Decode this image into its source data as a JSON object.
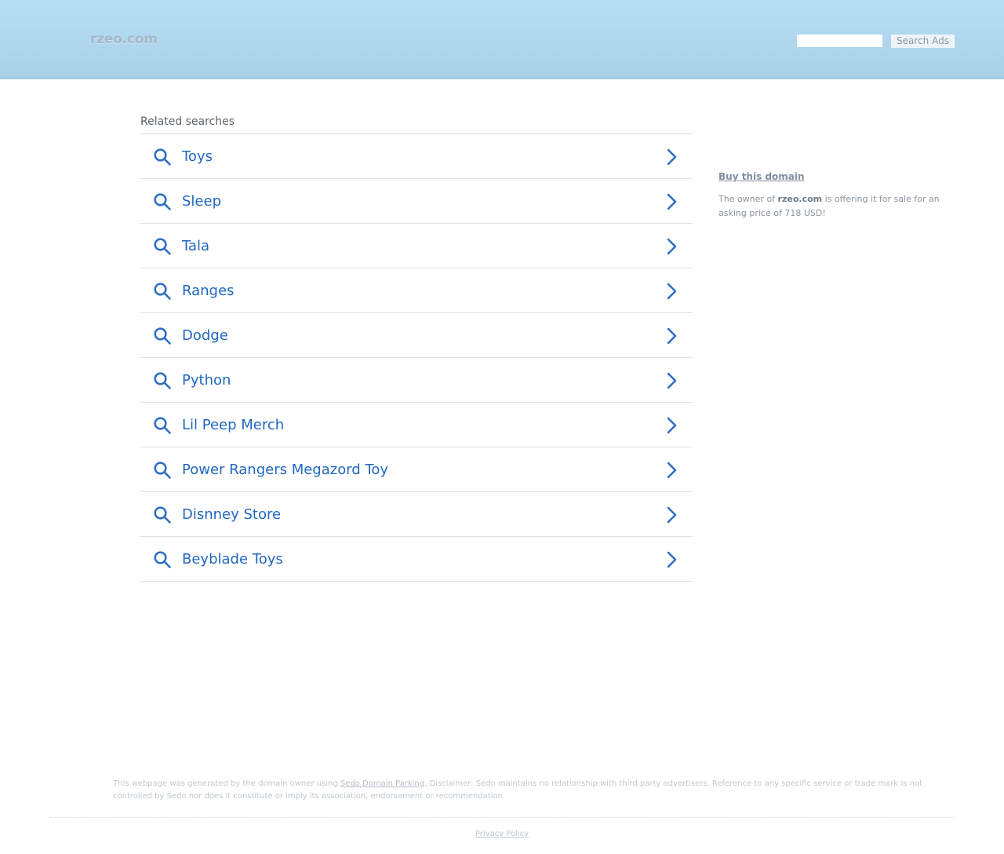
{
  "header": {
    "logo": "rzeo.com",
    "search": {
      "value": "",
      "placeholder": ""
    },
    "search_button_label": "Search Ads"
  },
  "related": {
    "title": "Related searches",
    "items": [
      {
        "label": "Toys"
      },
      {
        "label": "Sleep"
      },
      {
        "label": "Tala"
      },
      {
        "label": "Ranges"
      },
      {
        "label": "Dodge"
      },
      {
        "label": "Python"
      },
      {
        "label": "Lil Peep Merch"
      },
      {
        "label": "Power Rangers Megazord Toy"
      },
      {
        "label": "Disnney Store"
      },
      {
        "label": "Beyblade Toys"
      }
    ]
  },
  "sidebar": {
    "buy_link": "Buy this domain",
    "sale_prefix": "The owner of ",
    "sale_domain": "rzeo.com",
    "sale_suffix": " is offering it for sale for an asking price of 718 USD!"
  },
  "footer": {
    "disclaimer_prefix": "This webpage was generated by the domain owner using ",
    "disclaimer_link": "Sedo Domain Parking",
    "disclaimer_suffix": ". Disclaimer: Sedo maintains no relationship with third party advertisers. Reference to any specific service or trade mark is not controlled by Sedo nor does it constitute or imply its association, endorsement or recommendation.",
    "privacy_label": "Privacy Policy"
  },
  "colors": {
    "header_top": "#b6def3",
    "header_bottom": "#aad0e8",
    "link_blue": "#1f67c1",
    "icon_blue": "#2f6fc4"
  },
  "icons": {
    "result_leading": "search-icon",
    "result_trailing": "chevron-right-icon"
  }
}
